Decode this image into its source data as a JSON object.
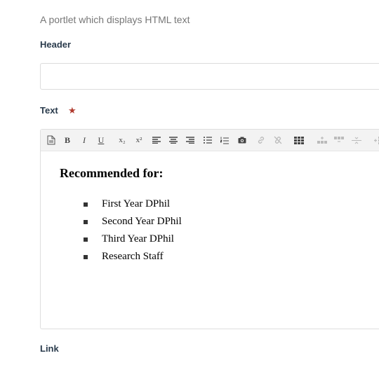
{
  "portlet": {
    "description": "A portlet which displays HTML text"
  },
  "fields": {
    "header": {
      "label": "Header",
      "value": "",
      "placeholder": ""
    },
    "text": {
      "label": "Text",
      "required_marker": "★"
    },
    "link": {
      "label": "Link"
    }
  },
  "toolbar": {
    "buttons": [
      {
        "name": "source-icon",
        "state": "enabled"
      },
      {
        "name": "bold-button",
        "glyph": "B",
        "state": "enabled"
      },
      {
        "name": "italic-button",
        "glyph": "I",
        "state": "enabled"
      },
      {
        "name": "underline-button",
        "glyph": "U",
        "state": "enabled"
      },
      {
        "name": "subscript-button",
        "glyph": "x₂",
        "state": "enabled"
      },
      {
        "name": "superscript-button",
        "glyph": "x²",
        "state": "enabled"
      },
      {
        "name": "align-left-icon",
        "state": "enabled"
      },
      {
        "name": "align-center-icon",
        "state": "enabled"
      },
      {
        "name": "align-right-icon",
        "state": "enabled"
      },
      {
        "name": "bulleted-list-icon",
        "state": "enabled"
      },
      {
        "name": "numbered-list-icon",
        "state": "enabled"
      },
      {
        "name": "image-icon",
        "state": "enabled"
      },
      {
        "name": "link-icon",
        "state": "disabled"
      },
      {
        "name": "unlink-icon",
        "state": "disabled"
      },
      {
        "name": "table-icon",
        "state": "enabled"
      },
      {
        "name": "insert-row-icon",
        "state": "disabled"
      },
      {
        "name": "delete-row-icon",
        "state": "disabled"
      },
      {
        "name": "horizontal-rule-icon",
        "state": "disabled"
      },
      {
        "name": "insert-column-icon",
        "state": "disabled"
      }
    ]
  },
  "editor_content": {
    "heading": "Recommended for:",
    "items": [
      "First Year DPhil",
      "Second Year DPhil",
      "Third Year DPhil",
      "Research Staff"
    ]
  },
  "colors": {
    "label": "#2a3b4c",
    "required": "#b03a2e",
    "description": "#777777",
    "toolbar_bg": "#f3f3f3"
  }
}
